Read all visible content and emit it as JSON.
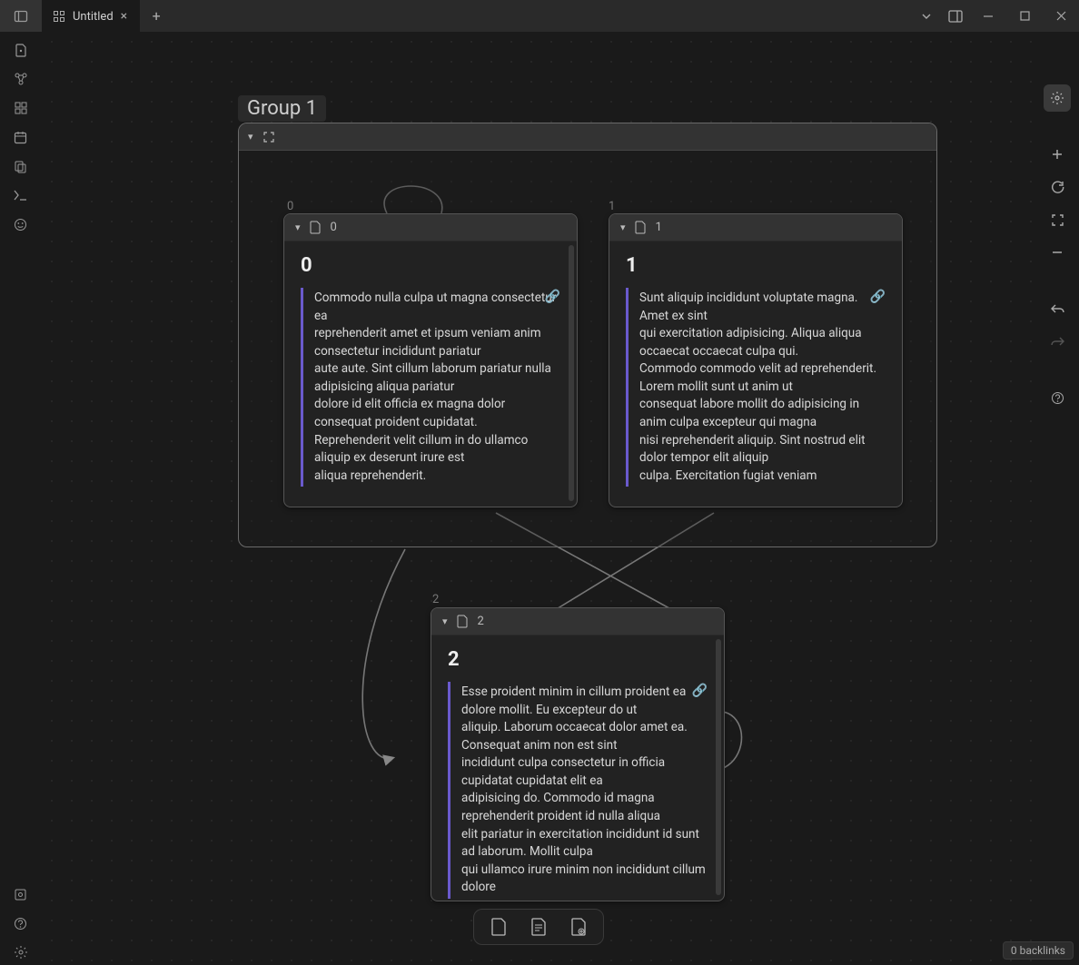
{
  "titlebar": {
    "tab_title": "Untitled",
    "close_glyph": "×",
    "plus_glyph": "+"
  },
  "nav": {
    "title": "Untitled",
    "back_glyph": "←",
    "fwd_glyph": "→",
    "menu_glyph": "⋮"
  },
  "group": {
    "title": "Group 1"
  },
  "cards": [
    {
      "index_label": "0",
      "header_title": "0",
      "heading": "0",
      "body": "Commodo nulla culpa ut magna consectetur ea\nreprehenderit amet et ipsum veniam anim consectetur incididunt pariatur\naute aute. Sint cillum laborum pariatur nulla adipisicing aliqua pariatur\ndolore id elit officia ex magna dolor consequat proident cupidatat.\nReprehenderit velit cillum in do ullamco aliquip ex deserunt irure est\naliqua reprehenderit."
    },
    {
      "index_label": "1",
      "header_title": "1",
      "heading": "1",
      "body": "Sunt aliquip incididunt voluptate magna. Amet ex sint\nqui exercitation adipisicing. Aliqua aliqua occaecat occaecat culpa qui.\nCommodo commodo velit ad reprehenderit. Lorem mollit sunt ut anim ut\nconsequat labore mollit do adipisicing in anim culpa excepteur qui magna\nnisi reprehenderit aliquip. Sint nostrud elit dolor tempor elit aliquip\nculpa. Exercitation fugiat veniam"
    },
    {
      "index_label": "2",
      "header_title": "2",
      "heading": "2",
      "body": "Esse proident minim in cillum proident ea dolore mollit. Eu excepteur do ut\naliquip. Laborum occaecat dolor amet ea. Consequat anim non est sint\nincididunt culpa consectetur in officia cupidatat cupidatat elit ea\nadipisicing do. Commodo id magna reprehenderit proident id nulla aliqua\nelit pariatur in exercitation incididunt id sunt ad laborum. Mollit culpa\nqui ullamco irure minim non incididunt cillum dolore"
    }
  ],
  "footer": {
    "backlinks": "0 backlinks"
  }
}
